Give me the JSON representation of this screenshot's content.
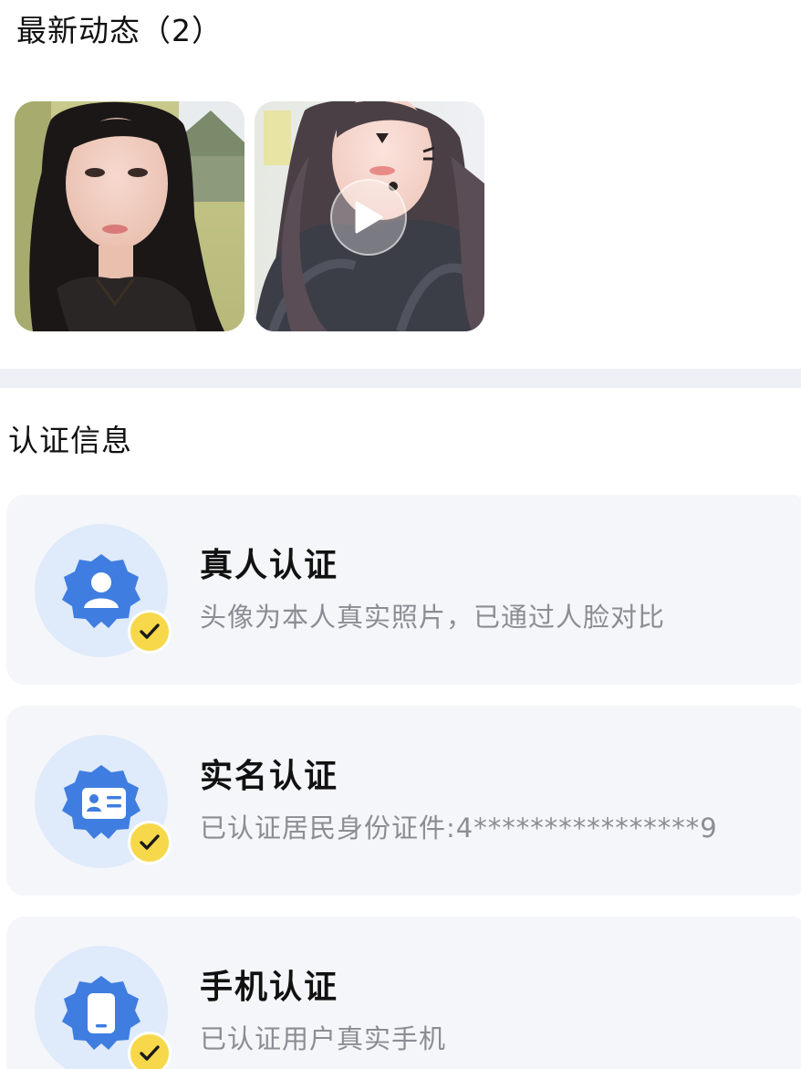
{
  "moments": {
    "title": "最新动态（2）",
    "items": [
      {
        "type": "photo",
        "icon": "photo-thumbnail"
      },
      {
        "type": "video",
        "icon": "play-icon"
      }
    ]
  },
  "verification": {
    "title": "认证信息",
    "cards": [
      {
        "title": "真人认证",
        "desc": "头像为本人真实照片，已通过人脸对比",
        "icon": "person-badge-icon",
        "status_icon": "check-icon"
      },
      {
        "title": "实名认证",
        "desc": "已认证居民身份证件:4****************9",
        "icon": "id-card-icon",
        "status_icon": "check-icon"
      },
      {
        "title": "手机认证",
        "desc": "已认证用户真实手机",
        "icon": "phone-icon",
        "status_icon": "check-icon"
      }
    ]
  },
  "colors": {
    "accent_blue": "#3f7de0",
    "icon_bg": "#dfeafb",
    "badge_yellow": "#f7d84a",
    "card_bg": "#f5f6f9",
    "desc_gray": "#8a8d94"
  }
}
